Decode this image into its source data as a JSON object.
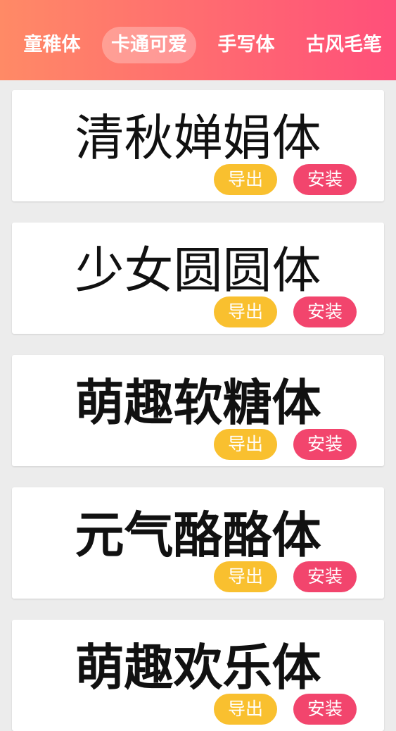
{
  "tabs": [
    {
      "label": "童稚体",
      "active": false
    },
    {
      "label": "卡通可爱",
      "active": true
    },
    {
      "label": "手写体",
      "active": false
    },
    {
      "label": "古风毛笔",
      "active": false
    }
  ],
  "cards": [
    {
      "sample": "清秋婵娟体",
      "export_label": "导出",
      "install_label": "安装"
    },
    {
      "sample": "少女圆圆体",
      "export_label": "导出",
      "install_label": "安装"
    },
    {
      "sample": "萌趣软糖体",
      "export_label": "导出",
      "install_label": "安装"
    },
    {
      "sample": "元气酪酪体",
      "export_label": "导出",
      "install_label": "安装"
    },
    {
      "sample": "萌趣欢乐体",
      "export_label": "导出",
      "install_label": "安装"
    }
  ],
  "colors": {
    "header_gradient_start": "#ff8a66",
    "header_gradient_end": "#ff4f7a",
    "export_button": "#f9c02f",
    "install_button": "#f2456d",
    "background": "#ececec"
  }
}
